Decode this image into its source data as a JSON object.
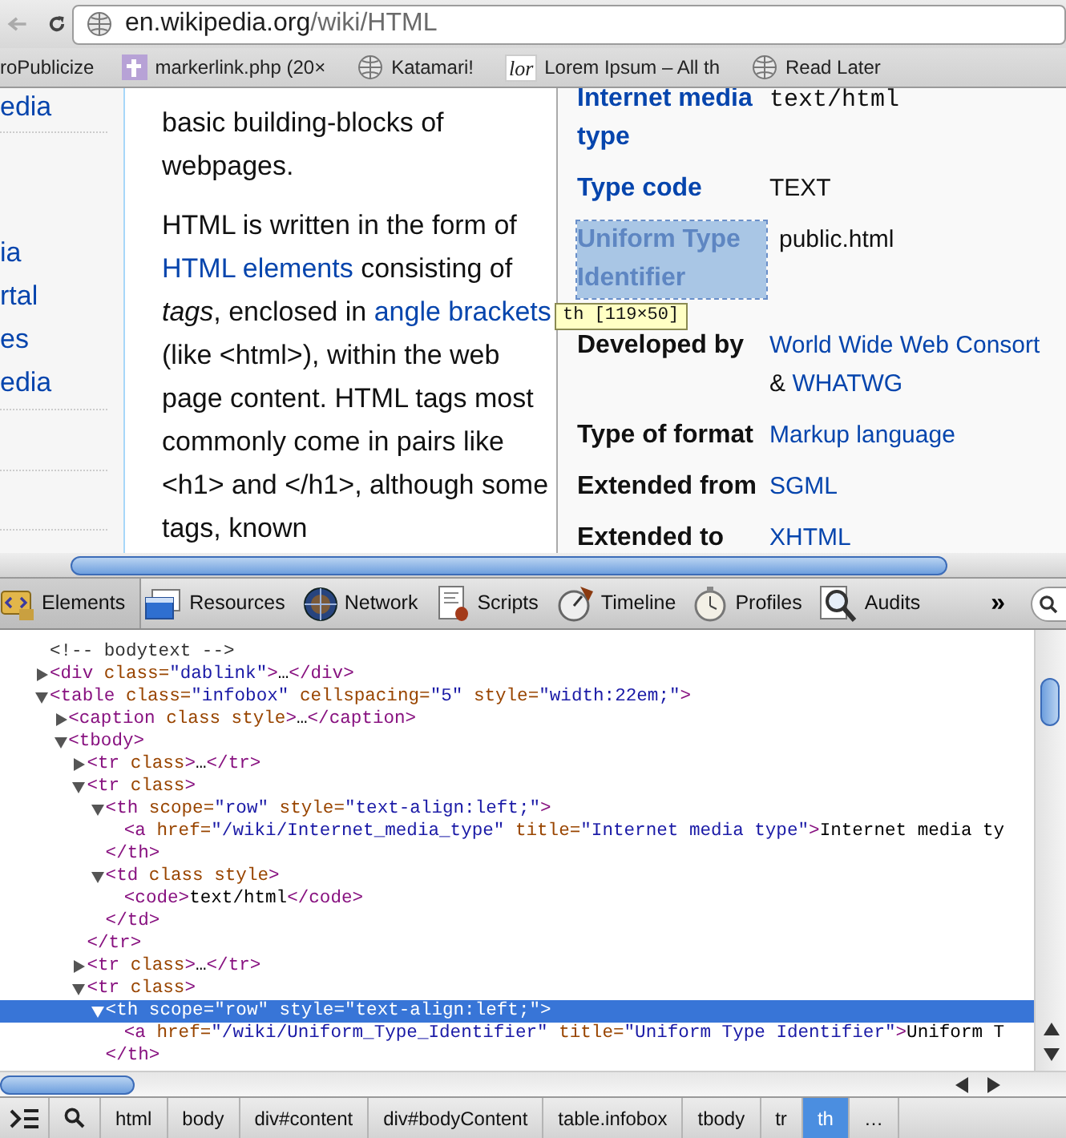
{
  "toolbar": {
    "url": {
      "host": "en.wikipedia.org",
      "path": "/wiki/HTML"
    }
  },
  "bookmarks": [
    {
      "label": "roPublicize",
      "kind": "plain"
    },
    {
      "label": "markerlink.php (20×",
      "kind": "image"
    },
    {
      "label": "Katamari!",
      "kind": "globe"
    },
    {
      "label": "Lorem Ipsum – All th",
      "kind": "lettered",
      "icon_text": "lor"
    },
    {
      "label": "Read Later",
      "kind": "globe"
    }
  ],
  "sidebar": {
    "links": [
      "edia",
      "ia",
      "rtal",
      "es",
      "edia"
    ]
  },
  "article": {
    "paragraphs": [
      [
        {
          "text": "basic building-blocks of webpages.",
          "kind": "text"
        }
      ],
      [
        {
          "text": "HTML is written in the form of ",
          "kind": "text"
        },
        {
          "text": "HTML elements",
          "kind": "link"
        },
        {
          "text": " consisting of ",
          "kind": "text"
        },
        {
          "text": "tags",
          "kind": "italic"
        },
        {
          "text": ", enclosed in ",
          "kind": "text"
        },
        {
          "text": "angle brackets",
          "kind": "link"
        },
        {
          "text": " (like <html>), within the web page content. HTML tags most commonly come in pairs like <h1> and </h1>, although some tags, known",
          "kind": "text"
        }
      ]
    ]
  },
  "infobox": {
    "rows": [
      {
        "label": "Internet media type",
        "label_link": true,
        "highlighted": false,
        "lines": [
          [
            {
              "text": "text/html",
              "kind": "code"
            }
          ]
        ]
      },
      {
        "label": "Type code",
        "label_link": true,
        "highlighted": false,
        "lines": [
          [
            {
              "text": "TEXT",
              "kind": "text"
            }
          ]
        ]
      },
      {
        "label": "Uniform Type Identifier",
        "label_link": true,
        "highlighted": true,
        "lines": [
          [
            {
              "text": "public.html",
              "kind": "text"
            }
          ]
        ]
      },
      {
        "label": "Developed by",
        "label_link": false,
        "highlighted": false,
        "lines": [
          [
            {
              "text": "World Wide Web Consort",
              "kind": "link"
            }
          ],
          [
            {
              "text": "& ",
              "kind": "text"
            },
            {
              "text": "WHATWG",
              "kind": "link"
            }
          ]
        ]
      },
      {
        "label": "Type of format",
        "label_link": false,
        "highlighted": false,
        "lines": [
          [
            {
              "text": "Markup language",
              "kind": "link"
            }
          ]
        ]
      },
      {
        "label": "Extended from",
        "label_link": false,
        "highlighted": false,
        "lines": [
          [
            {
              "text": "SGML",
              "kind": "link"
            }
          ]
        ]
      },
      {
        "label": "Extended to",
        "label_link": false,
        "highlighted": false,
        "lines": [
          [
            {
              "text": "XHTML",
              "kind": "link"
            }
          ]
        ]
      }
    ],
    "tooltip": "th [119×50]"
  },
  "devtools": {
    "tabs": [
      {
        "label": "Elements",
        "selected": true
      },
      {
        "label": "Resources",
        "selected": false
      },
      {
        "label": "Network",
        "selected": false
      },
      {
        "label": "Scripts",
        "selected": false
      },
      {
        "label": "Timeline",
        "selected": false
      },
      {
        "label": "Profiles",
        "selected": false
      },
      {
        "label": "Audits",
        "selected": false
      }
    ],
    "more": "»"
  },
  "dom": {
    "nodes": [
      {
        "text": "<!-- bodytext -->",
        "selected": false
      },
      {
        "text": "<div class=\"dablink\">…</div>",
        "expanded": false,
        "selected": false
      },
      {
        "text": "<table class=\"infobox\" cellspacing=\"5\" style=\"width:22em;\">",
        "expanded": true,
        "selected": false,
        "children": [
          {
            "text": "<caption class style>…</caption>",
            "expanded": false,
            "selected": false
          },
          {
            "text": "<tbody>",
            "expanded": true,
            "selected": false,
            "children": [
              {
                "text": "<tr class>…</tr>",
                "expanded": false,
                "selected": false
              },
              {
                "text": "<tr class>",
                "expanded": true,
                "selected": false,
                "close": "</tr>",
                "children": [
                  {
                    "text": "<th scope=\"row\" style=\"text-align:left;\">",
                    "expanded": true,
                    "selected": false,
                    "close": "</th>",
                    "children": [
                      {
                        "text": "<a href=\"/wiki/Internet_media_type\" title=\"Internet media type\">Internet media ty",
                        "selected": false
                      }
                    ]
                  },
                  {
                    "text": "<td class style>",
                    "expanded": true,
                    "selected": false,
                    "close": "</td>",
                    "children": [
                      {
                        "text": "<code>text/html</code>",
                        "selected": false
                      }
                    ]
                  }
                ]
              },
              {
                "text": "<tr class>…</tr>",
                "expanded": false,
                "selected": false
              },
              {
                "text": "<tr class>",
                "expanded": true,
                "selected": false,
                "children": [
                  {
                    "text": "<th scope=\"row\" style=\"text-align:left;\">",
                    "expanded": true,
                    "selected": true,
                    "close": "</th>",
                    "children": [
                      {
                        "text": "<a href=\"/wiki/Uniform_Type_Identifier\" title=\"Uniform Type Identifier\">Uniform T",
                        "selected": false
                      }
                    ]
                  }
                ]
              }
            ]
          }
        ]
      }
    ]
  },
  "breadcrumbs": [
    {
      "label": "html",
      "selected": false
    },
    {
      "label": "body",
      "selected": false
    },
    {
      "label": "div#content",
      "selected": false
    },
    {
      "label": "div#bodyContent",
      "selected": false
    },
    {
      "label": "table.infobox",
      "selected": false
    },
    {
      "label": "tbody",
      "selected": false
    },
    {
      "label": "tr",
      "selected": false
    },
    {
      "label": "th",
      "selected": true
    },
    {
      "label": "…",
      "selected": false
    }
  ]
}
